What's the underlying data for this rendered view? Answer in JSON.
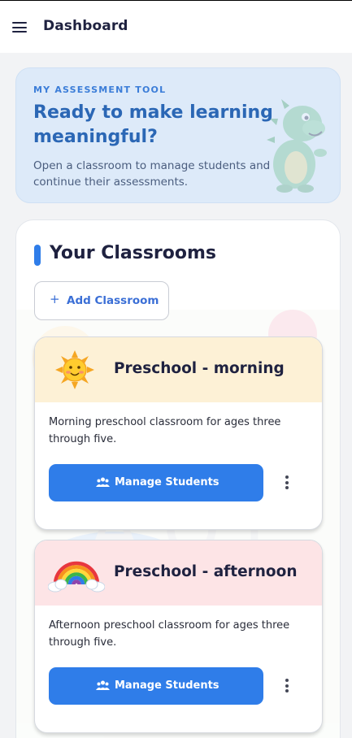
{
  "appbar": {
    "title": "Dashboard"
  },
  "hero": {
    "eyebrow": "MY ASSESSMENT TOOL",
    "title": "Ready to make learning meaningful?",
    "description": "Open a classroom to manage students and continue their assessments."
  },
  "classrooms": {
    "title": "Your Classrooms",
    "add_label": "Add Classroom",
    "add_icon": "+",
    "items": [
      {
        "name": "Preschool - morning",
        "icon": "sun-icon",
        "header_color": "#fdf1d6",
        "description": "Morning preschool classroom for ages three through five.",
        "button_label": "Manage Students"
      },
      {
        "name": "Preschool - afternoon",
        "icon": "rainbow-icon",
        "header_color": "#fde4e6",
        "description": "Afternoon preschool classroom for ages three through five.",
        "button_label": "Manage Students"
      }
    ]
  },
  "colors": {
    "accent": "#2f7de9",
    "hero_bg": "#ddeaf9",
    "hero_title": "#2b67b5"
  }
}
